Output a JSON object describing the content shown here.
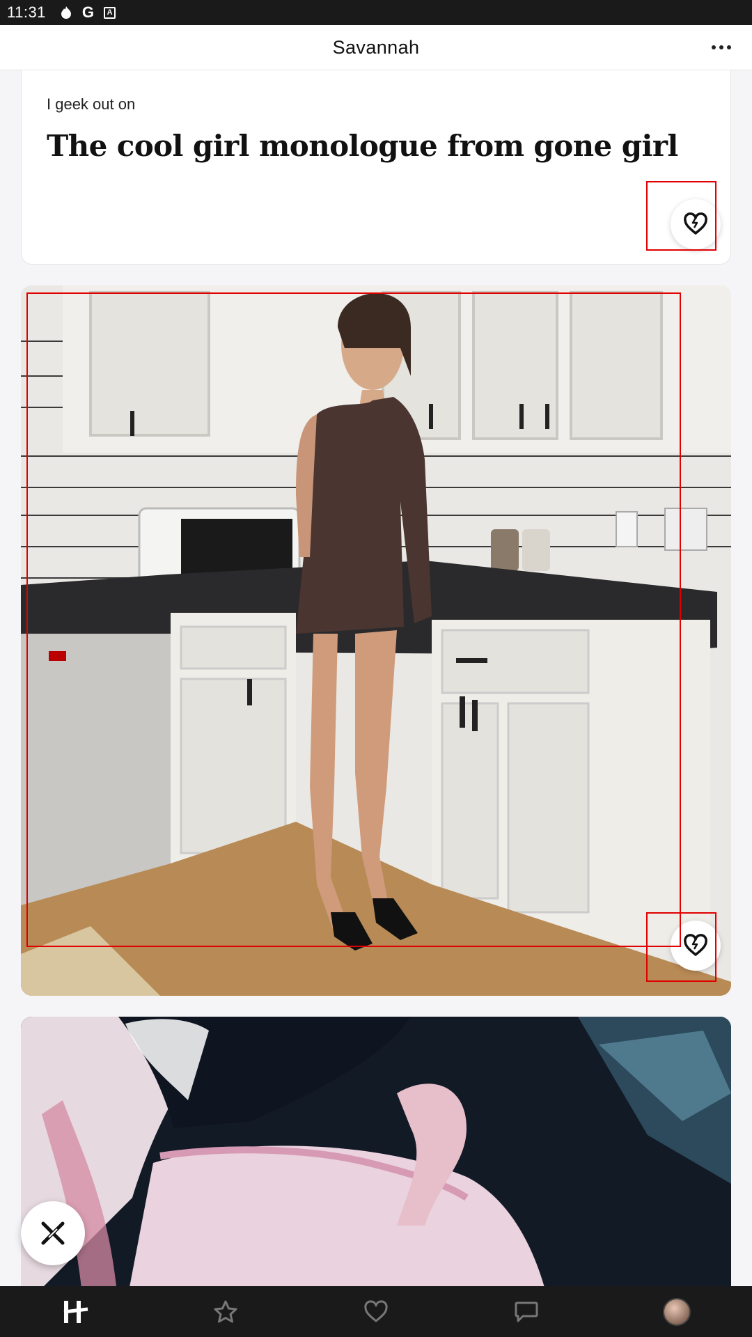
{
  "status_bar": {
    "time": "11:31",
    "icons": [
      "fire-icon",
      "google-icon",
      "a-box-icon"
    ]
  },
  "header": {
    "title": "Savannah",
    "more_icon": "more-dots-icon"
  },
  "prompt_card": {
    "question": "I geek out on",
    "answer": "The cool girl monologue from gone girl",
    "like_icon": "heart-icon"
  },
  "photo_cards": [
    {
      "subject": "photo",
      "like_icon": "heart-icon"
    },
    {
      "subject": "photo"
    }
  ],
  "skip_button": {
    "icon": "close-x-icon"
  },
  "bottom_nav": {
    "items": [
      "hinge-logo-icon",
      "star-icon",
      "heart-icon",
      "chat-bubble-icon",
      "avatar"
    ],
    "active_index": 0
  },
  "colors": {
    "status_bar_bg": "#1a1a1a",
    "nav_bg": "#1a1a1a",
    "annotation_red": "#e00000",
    "page_bg": "#f5f4f6"
  }
}
